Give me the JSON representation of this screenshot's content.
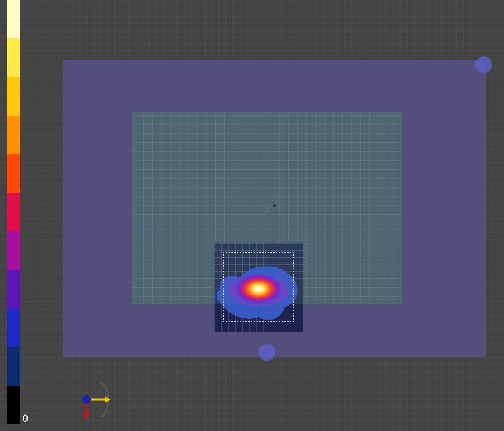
{
  "colorbar": {
    "min_label": "0",
    "colors": [
      "#fffcc6",
      "#ffe94d",
      "#ffc70e",
      "#ff9304",
      "#ff4909",
      "#e0104a",
      "#a6109e",
      "#5f14b8",
      "#1e2ac0",
      "#0c2d72",
      "#000000"
    ]
  },
  "scene": {
    "origin_label": "a",
    "outer_region_color": "#58528c",
    "inner_grid_color": "#4f6873",
    "heat_tile_color": "#1e2350",
    "handle_color": "#5c64d2",
    "selection_box_style": "dotted"
  },
  "axes_gizmo": {
    "x_axis_color": "#e6c814",
    "y_axis_color": "#1a22b8",
    "z_axis_color": "#c41a1a"
  }
}
